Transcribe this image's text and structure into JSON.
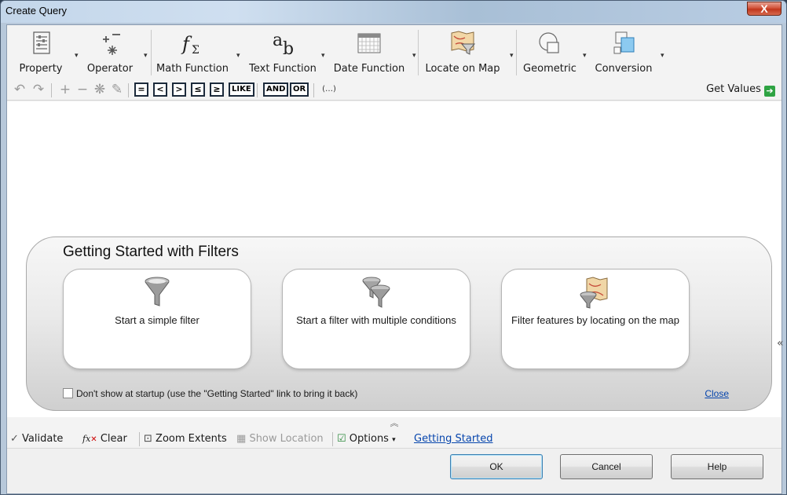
{
  "window": {
    "title": "Create Query",
    "close_glyph": "X"
  },
  "ribbon": {
    "groups": [
      {
        "label": "Property",
        "icon": "property-icon"
      },
      {
        "label": "Operator",
        "icon": "operator-icon"
      },
      {
        "label": "Math Function",
        "icon": "math-function-icon"
      },
      {
        "label": "Text Function",
        "icon": "text-function-icon"
      },
      {
        "label": "Date Function",
        "icon": "calendar-icon"
      },
      {
        "label": "Locate on Map",
        "icon": "map-filter-icon"
      },
      {
        "label": "Geometric",
        "icon": "geometric-icon"
      },
      {
        "label": "Conversion",
        "icon": "conversion-icon"
      }
    ]
  },
  "operators": {
    "eq": "=",
    "lt": "<",
    "gt": ">",
    "le": "≤",
    "ge": "≥",
    "like": "LIKE",
    "and": "AND",
    "or": "OR",
    "paren": "(…)"
  },
  "toolbar": {
    "get_values": "Get Values"
  },
  "getting_started": {
    "title": "Getting Started with Filters",
    "cards": [
      {
        "label": "Start a simple filter",
        "icon": "funnel-icon"
      },
      {
        "label": "Start a filter with multiple conditions",
        "icon": "multi-funnel-icon"
      },
      {
        "label": "Filter features by locating on the map",
        "icon": "map-funnel-icon"
      }
    ],
    "dont_show": "Don't show at startup (use the \"Getting Started\" link to bring it back)",
    "close": "Close"
  },
  "bottom": {
    "validate": "Validate",
    "clear": "Clear",
    "zoom_extents": "Zoom Extents",
    "show_location": "Show Location",
    "options": "Options",
    "getting_started": "Getting Started"
  },
  "buttons": {
    "ok": "OK",
    "cancel": "Cancel",
    "help": "Help"
  }
}
